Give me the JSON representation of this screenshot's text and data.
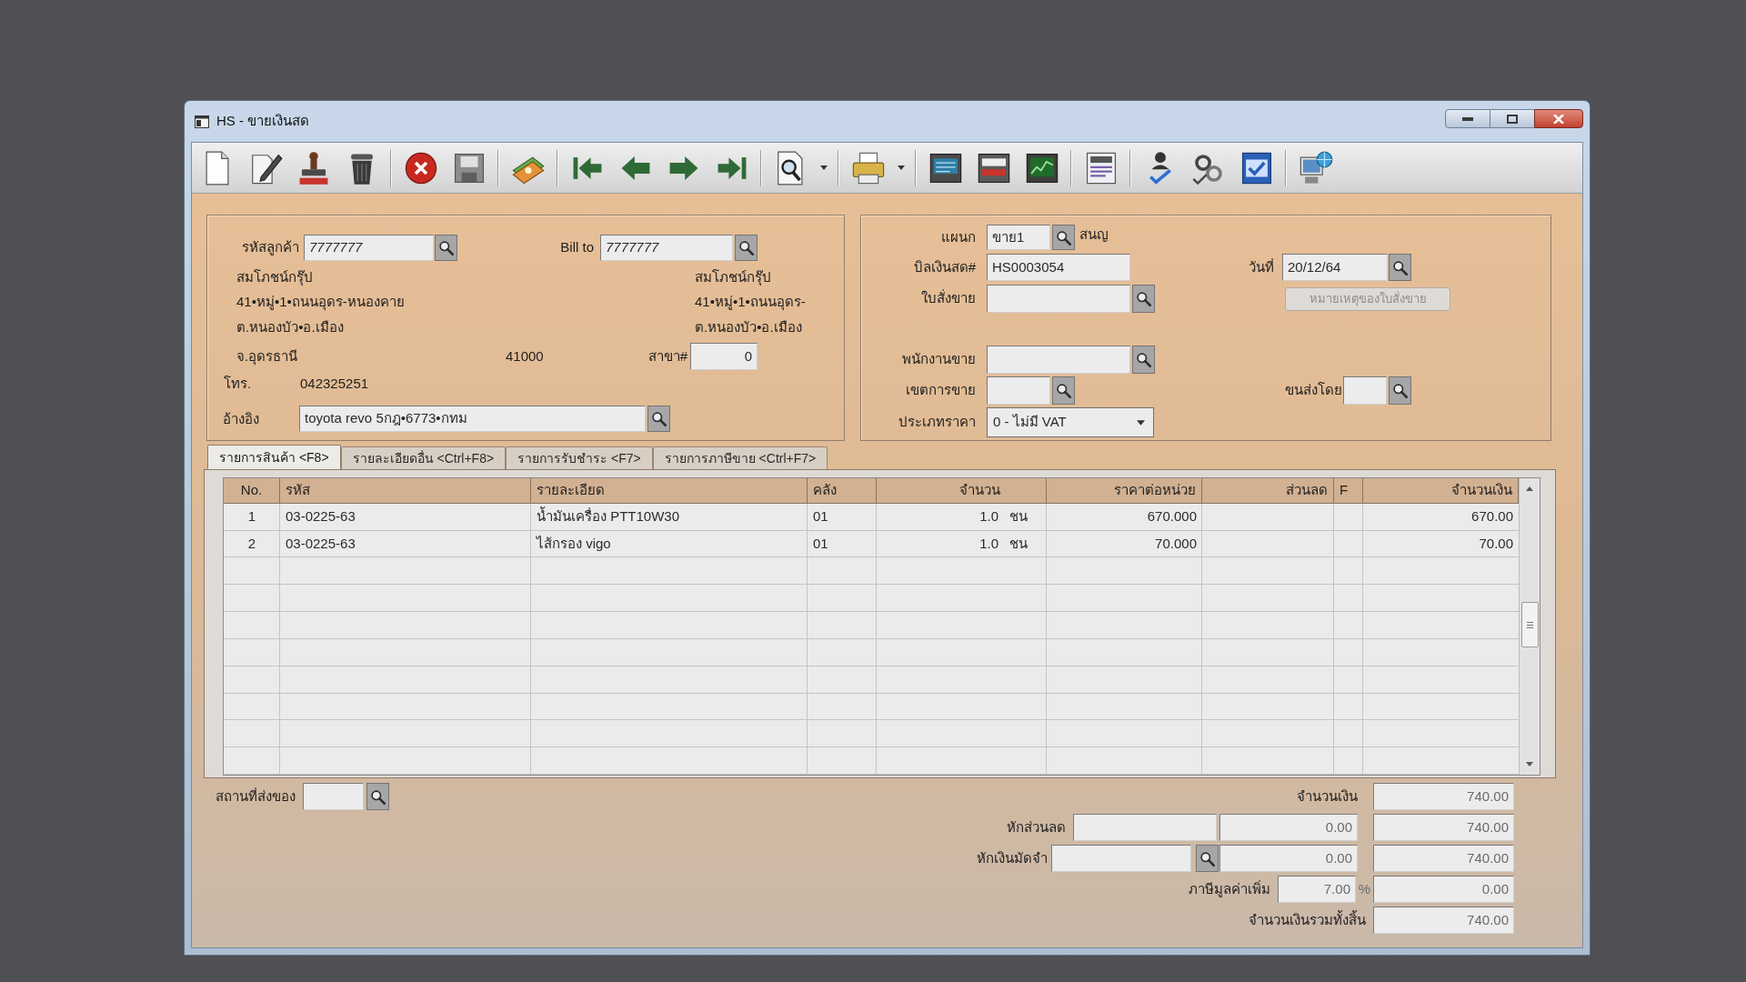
{
  "window": {
    "title": "HS - ขายเงินสด"
  },
  "customer": {
    "label": "รหัสลูกค้า",
    "code": "7777777",
    "name": "สมโภชน์กรุ๊ป",
    "address": [
      "41•หมู่•1•ถนนอุดร-หนองคาย",
      "ต.หนองบัว•อ.เมือง",
      "จ.อุดรธานี"
    ],
    "postcode": "41000",
    "phone_label": "โทร.",
    "phone": "042325251",
    "reference_label": "อ้างอิง",
    "reference": "toyota revo 5กฎ•6773•กทม"
  },
  "bill_to": {
    "label": "Bill to",
    "code": "7777777",
    "name": "สมโภชน์กรุ๊ป",
    "address": [
      "41•หมู่•1•ถนนอุดร-",
      "ต.หนองบัว•อ.เมือง"
    ],
    "branch_label": "สาขา#",
    "branch": "0"
  },
  "document": {
    "department_label": "แผนก",
    "department": "ขาย1",
    "department_name": "สนญ",
    "bill_label": "บิลเงินสด#",
    "bill_no": "HS0003054",
    "date_label": "วันที่",
    "date": "20/12/64",
    "order_label": "ใบสั่งขาย",
    "order_note_button": {
      "label": "หมายเหตุของใบสั่งขาย",
      "disabled": true
    },
    "salesperson_label": "พนักงานขาย",
    "sales_area_label": "เขตการขาย",
    "shipping_label": "ขนส่งโดย",
    "price_type_label": "ประเภทราคา",
    "price_type": "0 - ไม่มี VAT"
  },
  "tabs": [
    {
      "label": "รายการสินค้า <F8>",
      "selected": true
    },
    {
      "label": "รายละเอียดอื่น <Ctrl+F8>",
      "selected": false
    },
    {
      "label": "รายการรับชำระ <F7>",
      "selected": false
    },
    {
      "label": "รายการภาษีขาย <Ctrl+F7>",
      "selected": false
    }
  ],
  "table": {
    "columns": [
      "No.",
      "รหัส",
      "รายละเอียด",
      "คลัง",
      "จำนวน",
      "ราคาต่อหน่วย",
      "ส่วนลด",
      "F",
      "จำนวนเงิน"
    ],
    "rows": [
      {
        "no": "1",
        "code": "03-0225-63",
        "description": "น้ำมันเครื่อง PTT10W30",
        "warehouse": "01",
        "quantity": "1.0",
        "unit": "ชน",
        "unit_price": "670.000",
        "amount": "670.00"
      },
      {
        "no": "2",
        "code": "03-0225-63",
        "description": "ไส้กรอง vigo",
        "warehouse": "01",
        "quantity": "1.0",
        "unit": "ชน",
        "unit_price": "70.000",
        "amount": "70.00"
      }
    ]
  },
  "footer": {
    "delivery_label": "สถานที่ส่งของ",
    "totals": [
      {
        "kind": "subtotal",
        "label": "จำนวนเงิน",
        "total": "740.00"
      },
      {
        "kind": "discount",
        "label": "หักส่วนลด",
        "amount": "0.00",
        "total": "740.00"
      },
      {
        "kind": "deposit",
        "label": "หักเงินมัดจำ",
        "amount": "0.00",
        "total": "740.00"
      },
      {
        "kind": "vat",
        "label": "ภาษีมูลค่าเพิ่ม",
        "rate": "7.00",
        "unit": "%",
        "total": "0.00"
      },
      {
        "kind": "grand_total",
        "label": "จำนวนเงินรวมทั้งสิ้น",
        "total": "740.00"
      }
    ]
  }
}
